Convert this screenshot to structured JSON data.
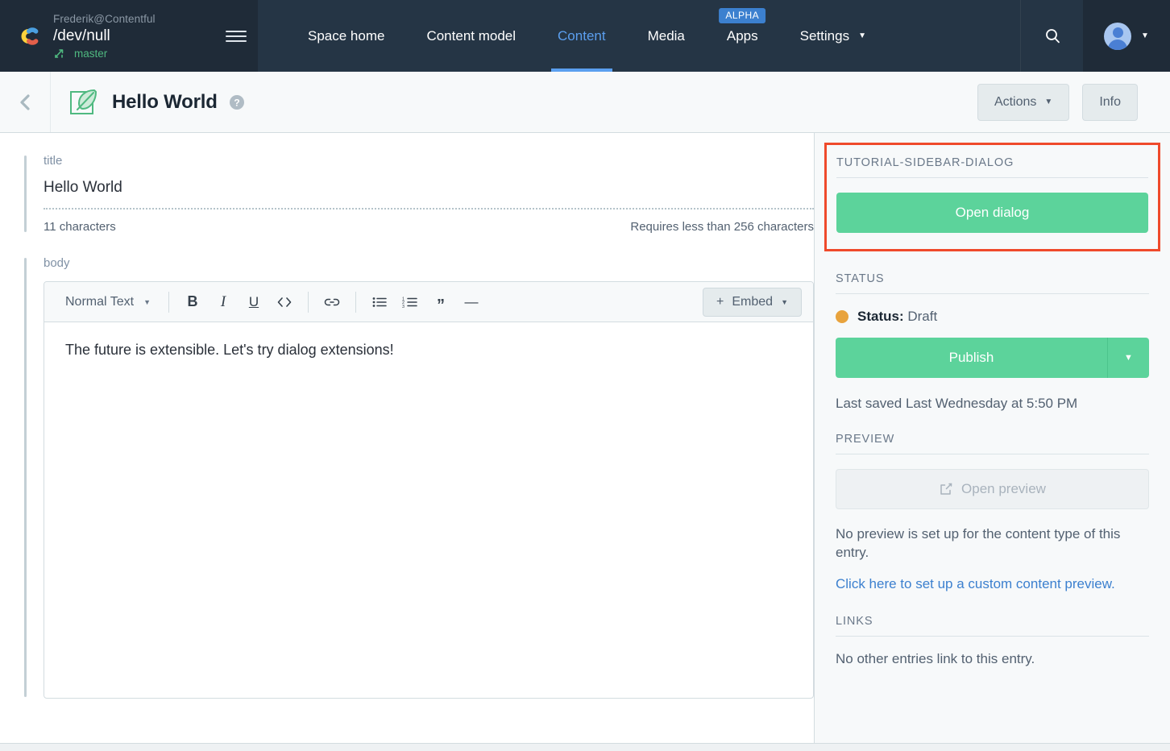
{
  "topnav": {
    "org": "Frederik@Contentful",
    "space": "/dev/null",
    "environment": "master",
    "menu_icon": "hamburger-icon",
    "items": [
      {
        "label": "Space home",
        "active": false
      },
      {
        "label": "Content model",
        "active": false
      },
      {
        "label": "Content",
        "active": true
      },
      {
        "label": "Media",
        "active": false
      },
      {
        "label": "Apps",
        "active": false,
        "badge": "ALPHA"
      },
      {
        "label": "Settings",
        "active": false,
        "caret": "▼"
      }
    ],
    "search_icon": "search-icon",
    "account_caret": "▼"
  },
  "entry_header": {
    "back_icon": "chevron-left-icon",
    "entry_icon": "entry-leaf-icon",
    "title": "Hello World",
    "help_icon": "help-circle-icon",
    "actions_label": "Actions",
    "actions_caret": "▼",
    "info_label": "Info"
  },
  "fields": {
    "title": {
      "label": "title",
      "value": "Hello World",
      "char_count": "11 characters",
      "validation": "Requires less than 256 characters"
    },
    "body": {
      "label": "body",
      "toolbar": {
        "style_select": "Normal Text",
        "style_caret": "▼",
        "bold": "B",
        "italic": "I",
        "underline": "U",
        "code": "< >",
        "link": "🔗",
        "bullet_list": "bulleted-list-icon",
        "numbered_list": "numbered-list-icon",
        "quote": "”",
        "hr": "—",
        "embed_plus": "+",
        "embed_label": "Embed",
        "embed_caret": "▼"
      },
      "content": "The future is extensible. Let's try dialog extensions!"
    }
  },
  "sidebar": {
    "dialog_section": {
      "heading": "TUTORIAL-SIDEBAR-DIALOG",
      "button_label": "Open dialog",
      "highlight_color": "#ef4a2b",
      "button_color": "#5cd39b"
    },
    "status_section": {
      "heading": "STATUS",
      "status_label": "Status:",
      "status_value": "Draft",
      "status_color": "#e8a33d",
      "publish_label": "Publish",
      "publish_caret": "▼",
      "last_saved": "Last saved Last Wednesday at 5:50 PM"
    },
    "preview_section": {
      "heading": "PREVIEW",
      "open_preview_icon": "external-link-icon",
      "open_preview_label": "Open preview",
      "note": "No preview is set up for the content type of this entry.",
      "link": "Click here to set up a custom content preview."
    },
    "links_section": {
      "heading": "LINKS",
      "note": "No other entries link to this entry."
    }
  }
}
